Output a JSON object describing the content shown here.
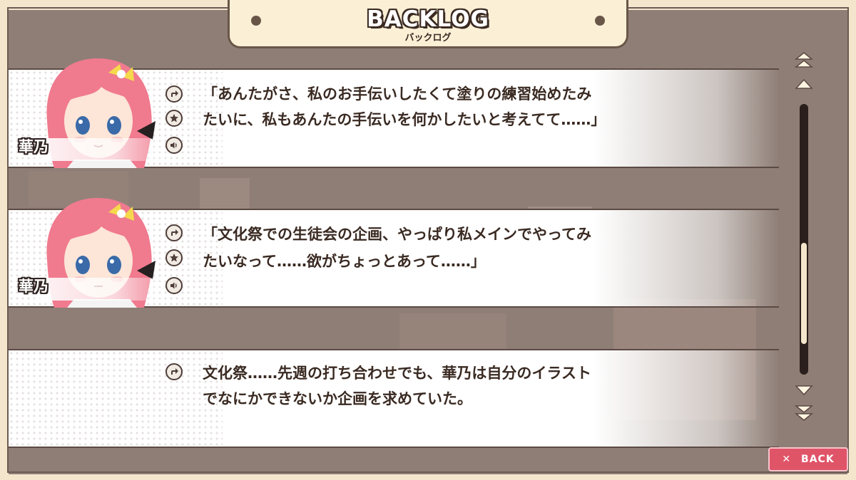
{
  "header": {
    "title": "BACKLOG",
    "subtitle": "バックログ"
  },
  "entries": [
    {
      "speaker": "華乃",
      "lines": [
        "「あんたがさ、私のお手伝いしたくて塗りの練習始めたみ",
        "たいに、私もあんたの手伝いを何かしたいと考えてて……」"
      ],
      "buttons": [
        "jump-icon",
        "star-icon",
        "voice-icon"
      ]
    },
    {
      "speaker": "華乃",
      "lines": [
        "「文化祭での生徒会の企画、やっぱり私メインでやってみ",
        "たいなって……欲がちょっとあって……」"
      ],
      "buttons": [
        "jump-icon",
        "star-icon",
        "voice-icon"
      ]
    },
    {
      "speaker": "",
      "lines": [
        "文化祭……先週の打ち合わせでも、華乃は自分のイラスト",
        "でなにかできないか企画を求めていた。"
      ],
      "buttons": [
        "jump-icon"
      ]
    }
  ],
  "scroll": {
    "buttons": [
      "scroll-top-icon",
      "scroll-up-icon",
      "scroll-down-icon",
      "scroll-bottom-icon"
    ],
    "position": 0.82
  },
  "back_button": {
    "icon": "close-icon",
    "label": "BACK"
  },
  "colors": {
    "frame": "#f3e6cc",
    "background": "#8e7e76",
    "text_dark": "#3a2a22",
    "back_button": "#e05468",
    "hair": "#f07a8e"
  }
}
